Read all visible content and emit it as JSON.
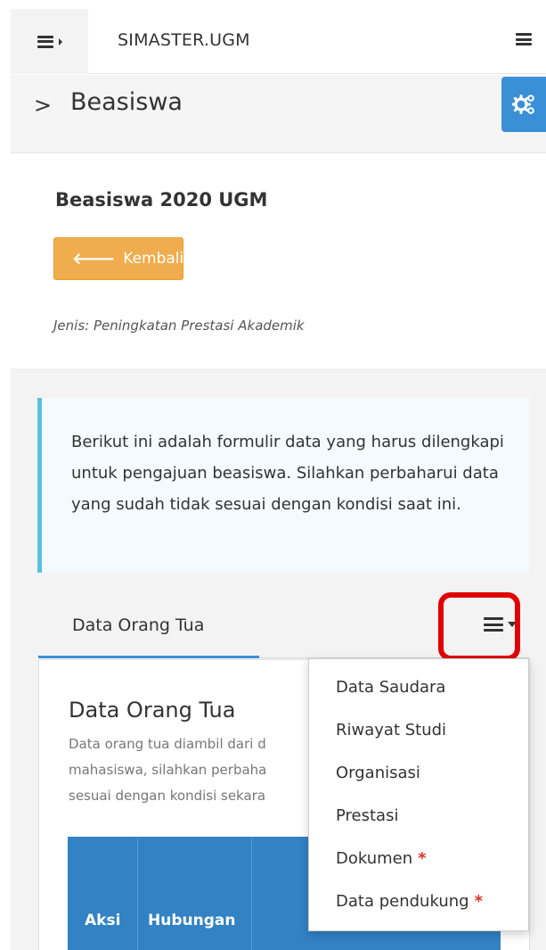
{
  "topbar": {
    "brand": "SIMASTER.UGM"
  },
  "breadcrumb": {
    "chevron": ">",
    "title": "Beasiswa"
  },
  "section": {
    "title": "Beasiswa 2020 UGM",
    "back_label": "Kembali",
    "jenis": "Jenis: Peningkatan Prestasi Akademik"
  },
  "info": {
    "text": "Berikut ini adalah formulir data yang harus dilengkapi untuk pengajuan beasiswa. Silahkan perbaharui data yang sudah tidak sesuai dengan kondisi saat ini."
  },
  "tabs": {
    "active": "Data Orang Tua"
  },
  "card": {
    "title": "Data Orang Tua",
    "desc_lines": [
      "Data orang tua diambil dari d",
      "mahasiswa, silahkan perbaha",
      "sesuai dengan kondisi sekara"
    ],
    "columns": [
      "Aksi",
      "Hubungan"
    ]
  },
  "dropdown": {
    "items": [
      {
        "label": "Data Saudara",
        "required": ""
      },
      {
        "label": "Riwayat Studi",
        "required": ""
      },
      {
        "label": "Organisasi",
        "required": ""
      },
      {
        "label": "Prestasi",
        "required": ""
      },
      {
        "label": "Dokumen",
        "required": "*"
      },
      {
        "label": "Data pendukung",
        "required": "*"
      }
    ]
  },
  "colors": {
    "accent": "#3a8fd6",
    "warning": "#f0ad4e",
    "info_border": "#5bc0de",
    "highlight": "#e00000",
    "table_header": "#3282c4"
  },
  "icons": [
    "hamburger-icon",
    "caret-right-icon",
    "gears-icon",
    "arrow-left-icon",
    "caret-down-icon"
  ]
}
